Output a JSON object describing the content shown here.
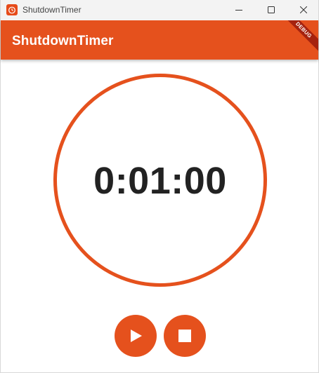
{
  "window": {
    "title": "ShutdownTimer",
    "icons": {
      "app": "alarm-clock-icon",
      "minimize": "minimize-icon",
      "maximize": "maximize-icon",
      "close": "close-icon"
    }
  },
  "appbar": {
    "title": "ShutdownTimer",
    "debug_banner": "DEBUG"
  },
  "timer": {
    "time": "0:01:00"
  },
  "controls": {
    "play_icon": "play-icon",
    "stop_icon": "stop-icon"
  },
  "colors": {
    "accent": "#e5511d",
    "debug_banner": "#a5220f",
    "text": "#222222"
  }
}
